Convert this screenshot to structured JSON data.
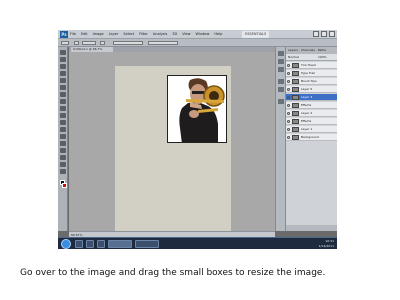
{
  "app": {
    "logo": "Ps",
    "menu": [
      "File",
      "Edit",
      "Image",
      "Layer",
      "Select",
      "Filter",
      "Analysis",
      "3D",
      "View",
      "Window",
      "Help"
    ],
    "workspace_label": "ESSENTIALS",
    "document_tab": "Untitled-1 @ 66.7%",
    "zoom": "66.67%"
  },
  "layers_panel": {
    "tabs": [
      "Layers",
      "Channels",
      "Paths"
    ],
    "blend_mode": "Normal",
    "opacity": "100%",
    "layers": [
      {
        "name": "Tire Tread",
        "selected": false
      },
      {
        "name": "Type Trail",
        "selected": false
      },
      {
        "name": "Brush Tips",
        "selected": false
      },
      {
        "name": "Layer 5",
        "selected": false
      },
      {
        "name": "Layer 3",
        "selected": true
      },
      {
        "name": "Effects",
        "selected": false
      },
      {
        "name": "Layer 2",
        "selected": false
      },
      {
        "name": "Effects",
        "selected": false
      },
      {
        "name": "Layer 1",
        "selected": false
      },
      {
        "name": "Background",
        "selected": false
      }
    ]
  },
  "taskbar": {
    "clock_time": "10:31",
    "clock_date": "1/14/2011"
  },
  "caption": "Go over to the image and drag the small boxes to resize the image."
}
